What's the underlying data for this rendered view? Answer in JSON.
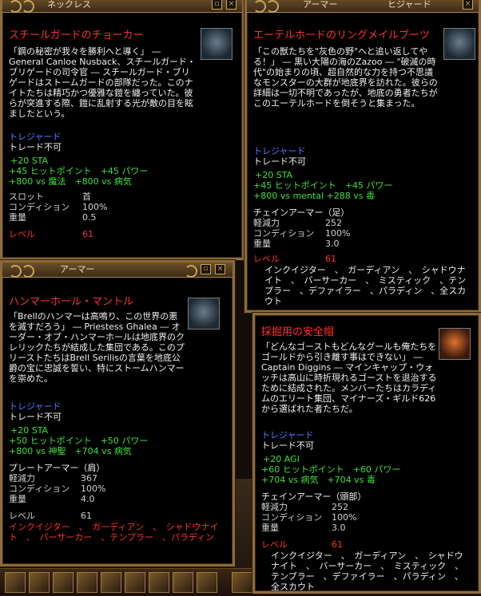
{
  "windows": {
    "choker": {
      "window_title": "ネックレス",
      "item_name": "スチールガードのチョーカー",
      "icon": "choker-icon",
      "description": "「鋼の秘密が我々を勝利へと導く」 ― General Canloe Nusback、スチールガード・ブリゲードの司令官 ― スチールガード・ブリゲードはストームガードの部隊だった。このナイトたちは精巧かつ優雅な鎧を纏っていた。彼らが突進する際、鎧に乱射する光が敵の目を眩ましたという。",
      "tradeskill_header": "トレジャード",
      "no_trade": "トレード不可",
      "stats": [
        "+20 STA",
        "+45 ヒットポイント　+45 パワー",
        "+800 vs 魔法　+800 vs 病気"
      ],
      "properties": [
        {
          "key": "スロット",
          "value": "首"
        },
        {
          "key": "コンディション",
          "value": "100%"
        },
        {
          "key": "重量",
          "value": "0.5"
        }
      ],
      "level_label": "レベル",
      "level_value": "61"
    },
    "boots": {
      "window_title": "アーマー",
      "window_title_2": "ヒジャード",
      "item_name": "エーテルホードのリングメイルブーツ",
      "icon": "boots-icon",
      "description": "「この獣たちを\"灰色の野\"へと追い返してやる！」 ― 黒い大陽の海のZazoo ― \"破滅の時代\"の始まりの頃、超自然的な力を持つ不思議なモンスターの大群が地底界を訪れた。彼らの詳細は一切不明であったが、地底の勇者たちがこのエーテルホードを倒そうと集まった。",
      "tradeskill_header": "トレジャード",
      "no_trade": "トレード不可",
      "stats": [
        "+20 STA",
        "+45 ヒットポイント　+45 パワー",
        "+800 vs mental +288 vs 毒"
      ],
      "armor_type": "チェインアーマー（足）",
      "properties": [
        {
          "key": "軽減力",
          "value": "252"
        },
        {
          "key": "コンディション",
          "value": "100%"
        },
        {
          "key": "重量",
          "value": "3.0"
        }
      ],
      "level_label": "レベル",
      "level_value": "61",
      "classes": "インクイジター　、　ガーディアン　、　シャドウナイト　、　バーサーカー　、　ミスティック　、テンプラー　、デファイラー　、パラディン　、全スカウト"
    },
    "mantle": {
      "window_title": "アーマー",
      "item_name": "ハンマーホール・マントル",
      "icon": "mantle-icon",
      "description": "「Brellのハンマーは高鳴り、この世界の悪を滅すだろう」 ― Priestess Ghalea ― オーダー・オブ・ハンマーホールは地底界のクレリックたちが結成した集団である。このプリーストたちはBrell Serilisの言葉を地底公爵の宝に忠誠を誓い、特にストームハンマーを崇めた。",
      "tradeskill_header": "トレジャード",
      "no_trade": "トレード不可",
      "stats": [
        "+20 STA",
        "+50 ヒットポイント　+50 パワー",
        "+800 vs 神聖　+704 vs 病気"
      ],
      "armor_type": "プレートアーマー（肩）",
      "properties": [
        {
          "key": "軽減力",
          "value": "367"
        },
        {
          "key": "コンディション",
          "value": "100%"
        },
        {
          "key": "重量",
          "value": "4.0"
        }
      ],
      "level_label": "レベル",
      "level_value": "61",
      "classes": "インクイジター　、　ガーディアン　、　シャドウナイト　、　バーサーカー　、テンプラー　、パラディン"
    },
    "helm": {
      "item_name": "採掘用の安全帽",
      "icon": "helm-icon",
      "description": "「どんなゴーストもどんなグールも俺たちをゴールドから引き離す事はできない」 ― Captain Diggins ― マインキャップ・ウォッチは高山に時折現れるゴーストを退治するために結成された。メンバーたちはカラディムのエリート集団、マイナーズ・ギルド626から選ばれた者たちだ。",
      "tradeskill_header": "トレジャード",
      "no_trade": "トレード不可",
      "stats": [
        "+20 AGI",
        "+60 ヒットポイント　+60 パワー",
        "+704 vs 病気　+704 vs 毒"
      ],
      "armor_type": "チェインアーマー（頭部）",
      "properties": [
        {
          "key": "軽減力",
          "value": "252"
        },
        {
          "key": "コンディション",
          "value": "100%"
        },
        {
          "key": "重量",
          "value": "3.0"
        }
      ],
      "level_label": "レベル",
      "level_value": "61",
      "classes": "インクイジター　、　ガーディアン　、　シャドウナイト　、　バーサーカー　、　ミスティック　、テンプラー　、デファイラー　、パラディン　、全スカウト"
    }
  },
  "colors": {
    "item_name": "#ff3030",
    "tradeskill": "#4d7cff",
    "stat_bonus": "#3de03d",
    "frame": "#8d6b3a"
  }
}
